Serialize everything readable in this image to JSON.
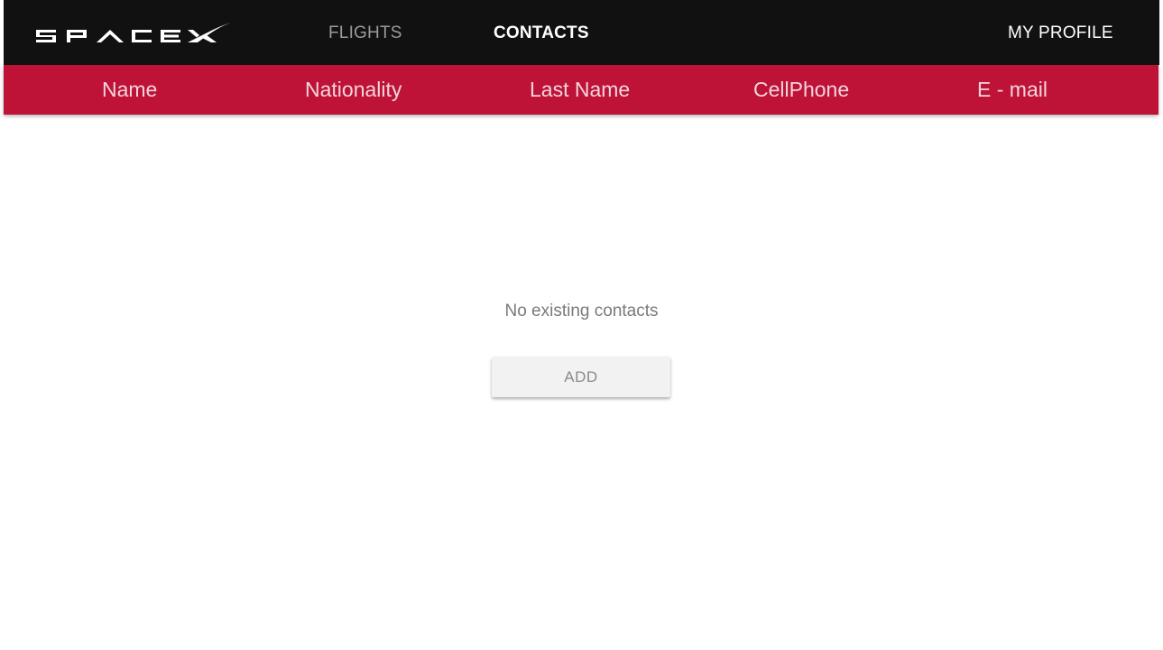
{
  "brand": {
    "logo_text": "SPACEX",
    "logo_icon": "spacex-logo-icon"
  },
  "nav": {
    "flights_label": "FLIGHTS",
    "contacts_label": "CONTACTS",
    "profile_label": "MY PROFILE",
    "active_tab": "CONTACTS"
  },
  "table": {
    "columns": [
      "Name",
      "Nationality",
      "Last Name",
      "CellPhone",
      "E - mail"
    ],
    "rows": []
  },
  "empty_state": {
    "message": "No existing contacts",
    "add_label": "ADD"
  },
  "colors": {
    "topbar_bg": "#111111",
    "header_bg": "#be1237",
    "nav_inactive": "#9a9a9a",
    "nav_active": "#ffffff",
    "empty_text": "#7a7a7a",
    "button_bg": "#f2f2f2"
  }
}
